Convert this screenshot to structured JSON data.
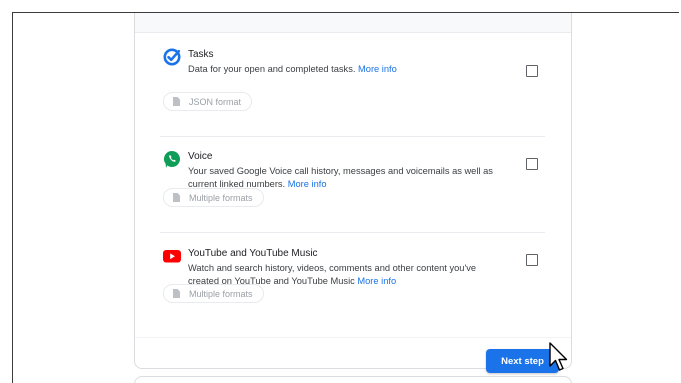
{
  "products": [
    {
      "id": "tasks",
      "name": "Tasks",
      "description": "Data for your open and completed tasks.",
      "more_info": "More info",
      "format": "JSON format",
      "checked": false,
      "icon": "tasks-icon"
    },
    {
      "id": "voice",
      "name": "Voice",
      "description": "Your saved Google Voice call history, messages and voicemails as well as current linked numbers.",
      "more_info": "More info",
      "format": "Multiple formats",
      "checked": false,
      "icon": "voice-icon"
    },
    {
      "id": "youtube",
      "name": "YouTube and YouTube Music",
      "description": "Watch and search history, videos, comments and other content you've created on YouTube and YouTube Music",
      "more_info": "More info",
      "format": "Multiple formats",
      "checked": false,
      "icon": "youtube-icon"
    }
  ],
  "footer": {
    "next_step_label": "Next step"
  },
  "colors": {
    "accent": "#1a73e8",
    "tasks_icon": "#1a73e8",
    "voice_icon": "#0f9d58",
    "youtube_icon": "#ff0000"
  }
}
